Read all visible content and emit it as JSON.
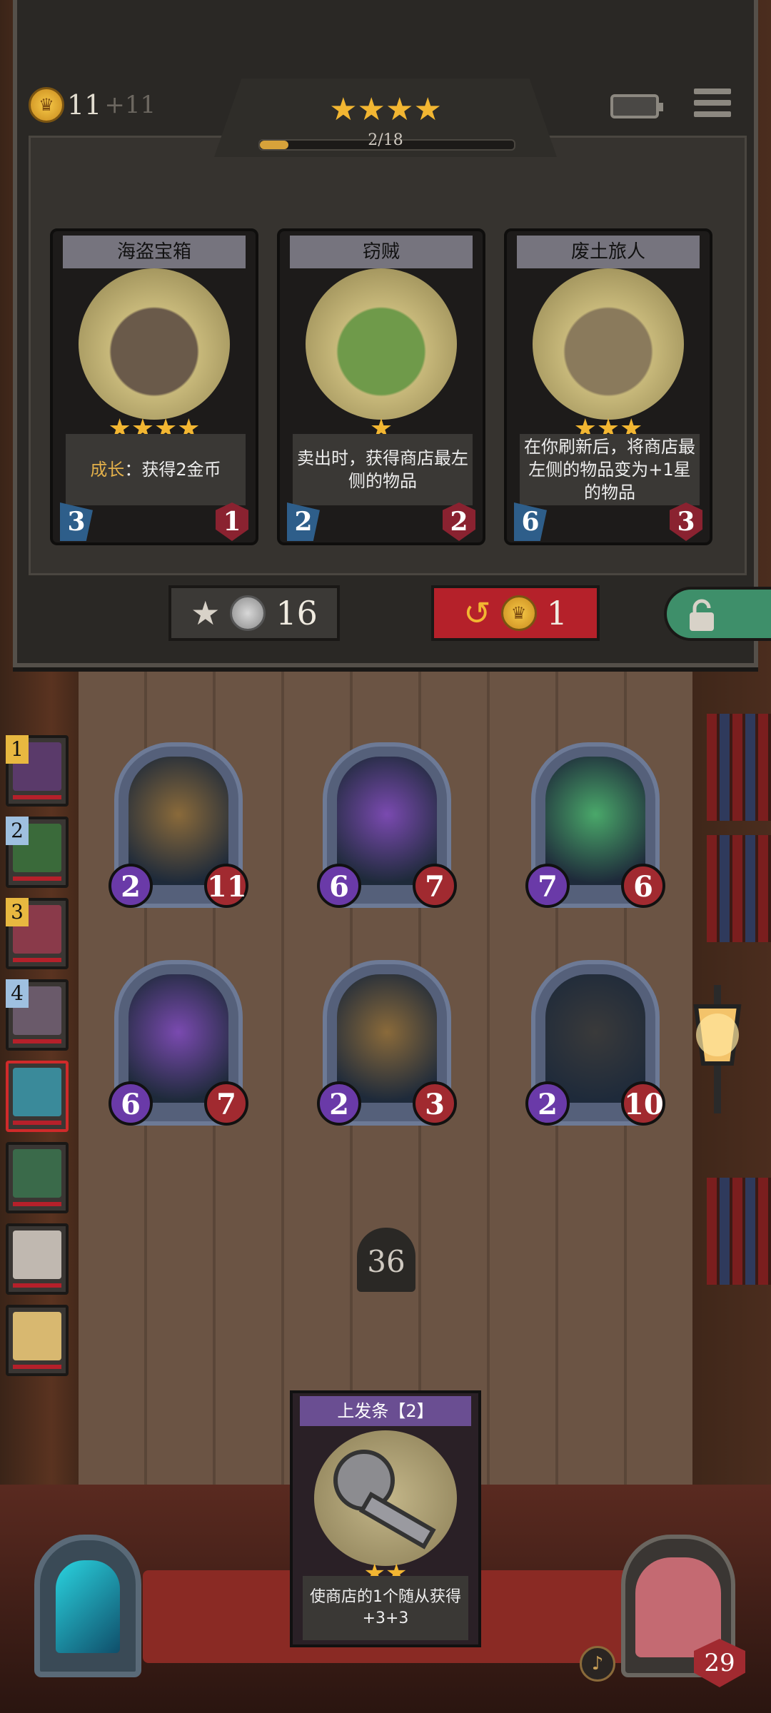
{
  "header": {
    "gold": "11",
    "gold_income": "+11",
    "tier_stars": "★★★★",
    "progress_text": "2/18",
    "progress_fraction": 0.111
  },
  "shop": {
    "cards": [
      {
        "name": "海盗宝箱",
        "stars": "★★★★",
        "desc_keyword": "成长",
        "desc": "：获得2金币",
        "attack": "3",
        "health": "1",
        "art_color": "#6a5a4a"
      },
      {
        "name": "窃贼",
        "stars": "★",
        "desc_keyword": "",
        "desc": "卖出时，获得商店最左侧的物品",
        "attack": "2",
        "health": "2",
        "art_color": "#6f9a4a"
      },
      {
        "name": "废土旅人",
        "stars": "★★★",
        "desc_keyword": "",
        "desc": "在你刷新后，将商店最左侧的物品变为+1星的物品",
        "attack": "6",
        "health": "3",
        "art_color": "#8a7a5c"
      }
    ],
    "upgrade_cost": "16",
    "refresh_cost": "1"
  },
  "team": [
    {
      "num": "1",
      "color": "#5a3a6a"
    },
    {
      "num": "2",
      "color": "#3a6a3a"
    },
    {
      "num": "3",
      "color": "#8a3a4a"
    },
    {
      "num": "4",
      "color": "#6a5a6a"
    },
    {
      "num": "",
      "color": "#3a8a9a",
      "active": true
    },
    {
      "num": "",
      "color": "#3a6a4a"
    },
    {
      "num": "",
      "color": "#c0b8b0"
    },
    {
      "num": "",
      "color": "#d8b870"
    }
  ],
  "board": [
    {
      "attack": "2",
      "health": "11",
      "color": "#8a6a3a"
    },
    {
      "attack": "6",
      "health": "7",
      "color": "#7a4ab0"
    },
    {
      "attack": "7",
      "health": "6",
      "color": "#4aa86a"
    },
    {
      "attack": "6",
      "health": "7",
      "color": "#7a4ab0"
    },
    {
      "attack": "2",
      "health": "3",
      "color": "#8a6a3a"
    },
    {
      "attack": "2",
      "health": "10",
      "color": "#3a3a3a"
    }
  ],
  "deck_count": "36",
  "spell": {
    "title": "上发条【2】",
    "stars": "★★",
    "desc": "使商店的1个随从获得+3+3"
  },
  "hero_health": "29",
  "icons": {
    "gold": "coin-icon",
    "battery": "battery-icon",
    "menu": "menu-icon",
    "upgrade": "star-up-icon",
    "refresh": "refresh-icon",
    "lock": "lock-icon",
    "bell": "bell-icon"
  }
}
